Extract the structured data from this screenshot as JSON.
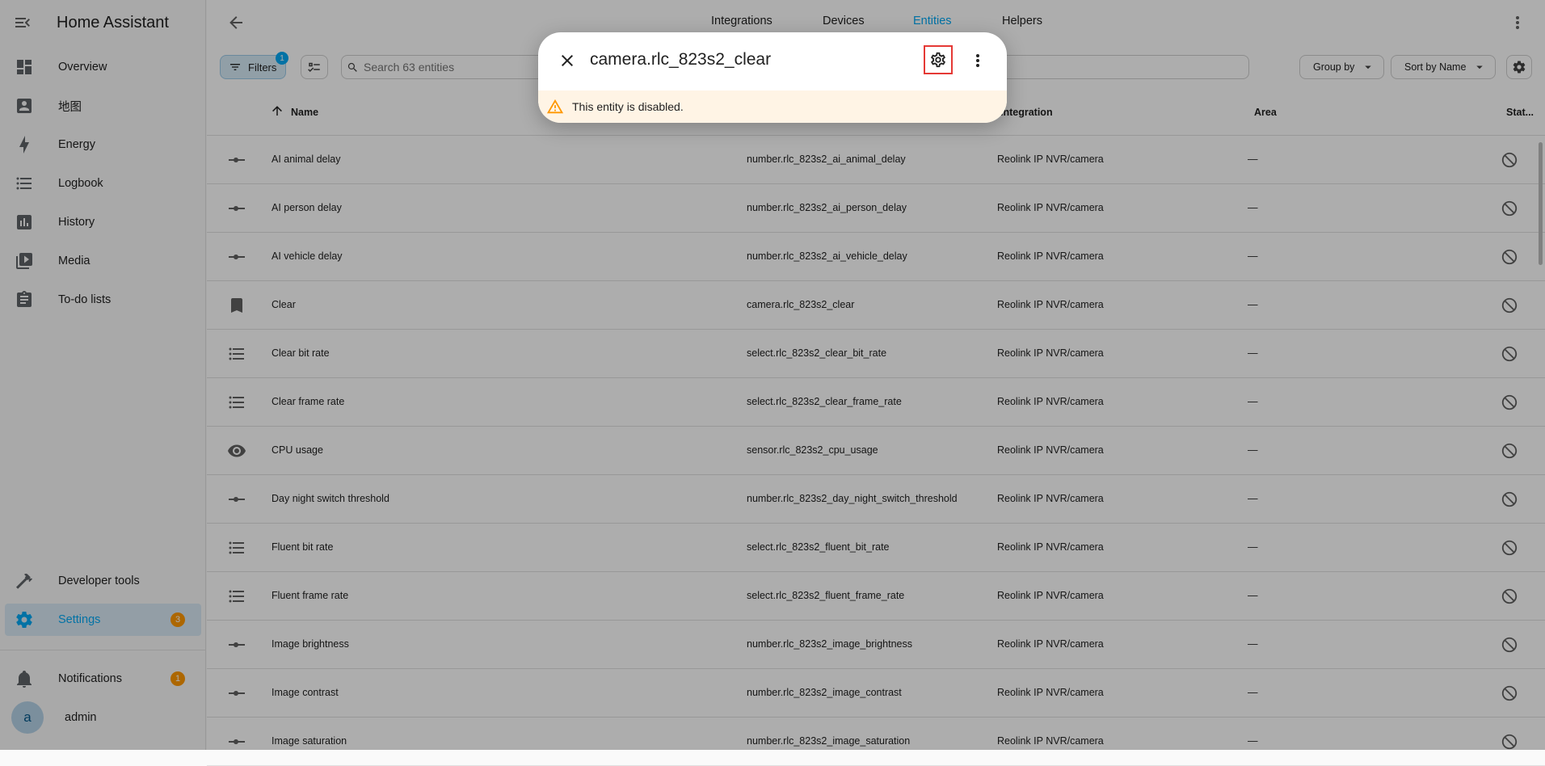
{
  "sidebar": {
    "title": "Home Assistant",
    "items": [
      {
        "label": "Overview",
        "icon": "dashboard-icon"
      },
      {
        "label": "地图",
        "icon": "account-box-icon"
      },
      {
        "label": "Energy",
        "icon": "lightning-bolt-icon"
      },
      {
        "label": "Logbook",
        "icon": "format-list-bulleted-icon"
      },
      {
        "label": "History",
        "icon": "chart-box-icon"
      },
      {
        "label": "Media",
        "icon": "play-box-multiple-icon"
      },
      {
        "label": "To-do lists",
        "icon": "clipboard-list-icon"
      }
    ],
    "developer_tools": "Developer tools",
    "settings": {
      "label": "Settings",
      "badge": "3"
    },
    "notifications": {
      "label": "Notifications",
      "badge": "1"
    },
    "user": {
      "initial": "a",
      "name": "admin"
    }
  },
  "topbar": {
    "tabs": [
      "Integrations",
      "Devices",
      "Entities",
      "Helpers"
    ],
    "active_tab": "Entities"
  },
  "toolbar": {
    "filters_label": "Filters",
    "filters_badge": "1",
    "search_placeholder": "Search 63 entities",
    "group_by_label": "Group by",
    "sort_label": "Sort by Name"
  },
  "table": {
    "headers": {
      "name": "Name",
      "integration": "Integration",
      "area": "Area",
      "status": "Stat..."
    },
    "rows": [
      {
        "icon": "slider-icon",
        "name": "AI animal delay",
        "entity_id": "number.rlc_823s2_ai_animal_delay",
        "integration": "Reolink IP NVR/camera",
        "area": "—"
      },
      {
        "icon": "slider-icon",
        "name": "AI person delay",
        "entity_id": "number.rlc_823s2_ai_person_delay",
        "integration": "Reolink IP NVR/camera",
        "area": "—"
      },
      {
        "icon": "slider-icon",
        "name": "AI vehicle delay",
        "entity_id": "number.rlc_823s2_ai_vehicle_delay",
        "integration": "Reolink IP NVR/camera",
        "area": "—"
      },
      {
        "icon": "bookmark-icon",
        "name": "Clear",
        "entity_id": "camera.rlc_823s2_clear",
        "integration": "Reolink IP NVR/camera",
        "area": "—"
      },
      {
        "icon": "list-icon",
        "name": "Clear bit rate",
        "entity_id": "select.rlc_823s2_clear_bit_rate",
        "integration": "Reolink IP NVR/camera",
        "area": "—"
      },
      {
        "icon": "list-icon",
        "name": "Clear frame rate",
        "entity_id": "select.rlc_823s2_clear_frame_rate",
        "integration": "Reolink IP NVR/camera",
        "area": "—"
      },
      {
        "icon": "eye-icon",
        "name": "CPU usage",
        "entity_id": "sensor.rlc_823s2_cpu_usage",
        "integration": "Reolink IP NVR/camera",
        "area": "—"
      },
      {
        "icon": "slider-icon",
        "name": "Day night switch threshold",
        "entity_id": "number.rlc_823s2_day_night_switch_threshold",
        "integration": "Reolink IP NVR/camera",
        "area": "—"
      },
      {
        "icon": "list-icon",
        "name": "Fluent bit rate",
        "entity_id": "select.rlc_823s2_fluent_bit_rate",
        "integration": "Reolink IP NVR/camera",
        "area": "—"
      },
      {
        "icon": "list-icon",
        "name": "Fluent frame rate",
        "entity_id": "select.rlc_823s2_fluent_frame_rate",
        "integration": "Reolink IP NVR/camera",
        "area": "—"
      },
      {
        "icon": "slider-icon",
        "name": "Image brightness",
        "entity_id": "number.rlc_823s2_image_brightness",
        "integration": "Reolink IP NVR/camera",
        "area": "—"
      },
      {
        "icon": "slider-icon",
        "name": "Image contrast",
        "entity_id": "number.rlc_823s2_image_contrast",
        "integration": "Reolink IP NVR/camera",
        "area": "—"
      },
      {
        "icon": "slider-icon",
        "name": "Image saturation",
        "entity_id": "number.rlc_823s2_image_saturation",
        "integration": "Reolink IP NVR/camera",
        "area": "—"
      }
    ]
  },
  "dialog": {
    "title": "camera.rlc_823s2_clear",
    "alert": "This entity is disabled."
  },
  "colors": {
    "accent": "#03a9f4",
    "badge": "#ff9800",
    "highlight_border": "#e53935",
    "alert_bg": "#fff4e5",
    "warning": "#ff9800"
  }
}
